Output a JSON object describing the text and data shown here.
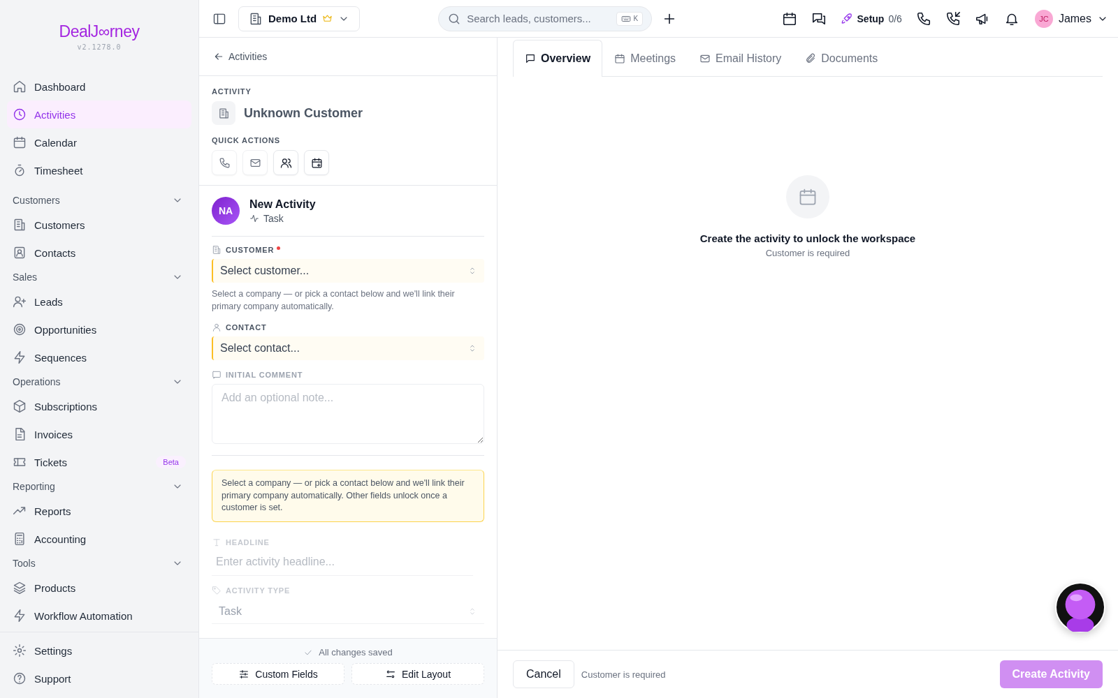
{
  "brand": {
    "name": "DealJ∞rney",
    "version": "v2.1278.0"
  },
  "sidebar": {
    "top": [
      {
        "label": "Dashboard",
        "selected": false
      },
      {
        "label": "Activities",
        "selected": true
      },
      {
        "label": "Calendar",
        "selected": false
      },
      {
        "label": "Timesheet",
        "selected": false
      }
    ],
    "groups": [
      {
        "title": "Customers",
        "expanded": true,
        "items": [
          {
            "label": "Customers",
            "selected": false
          },
          {
            "label": "Contacts",
            "selected": false
          }
        ]
      },
      {
        "title": "Sales",
        "expanded": true,
        "items": [
          {
            "label": "Leads",
            "selected": false
          },
          {
            "label": "Opportunities",
            "selected": false
          },
          {
            "label": "Sequences",
            "selected": false
          }
        ]
      },
      {
        "title": "Operations",
        "expanded": true,
        "items": [
          {
            "label": "Subscriptions",
            "selected": false
          },
          {
            "label": "Invoices",
            "selected": false
          },
          {
            "label": "Tickets",
            "selected": false,
            "badge": "Beta"
          }
        ]
      },
      {
        "title": "Reporting",
        "expanded": true,
        "items": [
          {
            "label": "Reports",
            "selected": false
          },
          {
            "label": "Accounting",
            "selected": false
          }
        ]
      },
      {
        "title": "Tools",
        "expanded": true,
        "items": [
          {
            "label": "Products",
            "selected": false
          },
          {
            "label": "Workflow Automation",
            "selected": false
          }
        ]
      }
    ],
    "bottom": [
      {
        "label": "Settings",
        "selected": false
      },
      {
        "label": "Support",
        "selected": false
      }
    ]
  },
  "top_bar": {
    "company": "Demo Ltd",
    "search": {
      "placeholder": "Search leads, customers...",
      "shortcut": "K"
    },
    "setup": {
      "label": "Setup",
      "progress": "0/6"
    },
    "user": {
      "initials": "JC",
      "name": "James"
    }
  },
  "activity_panel": {
    "back": "Activities",
    "section_label": "ACTIVITY",
    "customer": "Unknown Customer",
    "quick_actions_label": "QUICK ACTIONS",
    "quick_actions": [
      {
        "disabled": true
      },
      {
        "disabled": true
      },
      {
        "disabled": false
      },
      {
        "disabled": false
      }
    ],
    "record": {
      "initials": "NA",
      "title": "New Activity",
      "type": "Task"
    },
    "fields": [
      {
        "kind": "select",
        "label": "CUSTOMER",
        "required": true,
        "disabled": false,
        "placeholder": "Select customer...",
        "hint": "Select a company — or pick a contact below and we'll link their primary company automatically."
      },
      {
        "kind": "select",
        "label": "CONTACT",
        "disabled": false,
        "placeholder": "Select contact..."
      },
      {
        "kind": "textarea",
        "label": "INITIAL COMMENT",
        "disabled": false,
        "placeholder": "Add an optional note..."
      }
    ],
    "notice": "Select a company — or pick a contact below and we'll link their primary company automatically. Other fields unlock once a customer is set.",
    "locked_fields": [
      {
        "kind": "text",
        "label": "HEADLINE",
        "disabled": true,
        "placeholder": "Enter activity headline..."
      },
      {
        "kind": "select",
        "label": "ACTIVITY TYPE",
        "disabled": true,
        "value": "Task"
      }
    ],
    "save_status": "All changes saved",
    "footer_buttons": [
      "Custom Fields",
      "Edit Layout"
    ]
  },
  "workspace": {
    "tabs": [
      {
        "label": "Overview",
        "selected": true
      },
      {
        "label": "Meetings",
        "selected": false
      },
      {
        "label": "Email History",
        "selected": false
      },
      {
        "label": "Documents",
        "selected": false
      }
    ],
    "empty_title": "Create the activity to unlock the workspace",
    "empty_subtitle": "Customer is required",
    "cancel": "Cancel",
    "validation": "Customer is required",
    "submit": {
      "label": "Create Activity",
      "disabled": true
    }
  }
}
